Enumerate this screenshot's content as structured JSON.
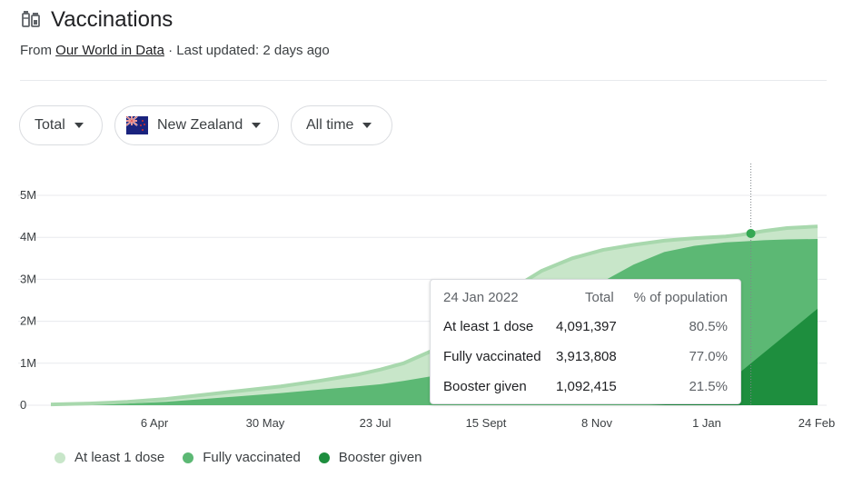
{
  "header": {
    "title": "Vaccinations",
    "source_prefix": "From ",
    "source_link": "Our World in Data",
    "source_suffix": " · Last updated: 2 days ago"
  },
  "filters": {
    "metric": "Total",
    "country": "New Zealand",
    "range": "All time"
  },
  "tooltip": {
    "date": "24 Jan 2022",
    "col_total": "Total",
    "col_pct": "% of population",
    "rows": [
      {
        "label": "At least 1 dose",
        "total": "4,091,397",
        "pct": "80.5%"
      },
      {
        "label": "Fully vaccinated",
        "total": "3,913,808",
        "pct": "77.0%"
      },
      {
        "label": "Booster given",
        "total": "1,092,415",
        "pct": "21.5%"
      }
    ]
  },
  "colors": {
    "at_least_one": "#c8e6c9",
    "at_least_one_line": "#a8d8ad",
    "fully": "#5cb874",
    "booster": "#1e8e3e",
    "grid": "#e8eaed",
    "marker": "#34a853"
  },
  "chart_data": {
    "type": "area",
    "x_ticks": [
      "6 Apr",
      "30 May",
      "23 Jul",
      "15 Sept",
      "8 Nov",
      "1 Jan",
      "24 Feb"
    ],
    "y_ticks": [
      "0",
      "1M",
      "2M",
      "3M",
      "4M",
      "5M"
    ],
    "ylim": [
      0,
      5000000
    ],
    "hover_date": "24 Jan 2022",
    "hover_x_fraction": 0.913,
    "series": [
      {
        "name": "At least 1 dose",
        "x": [
          0,
          0.05,
          0.1,
          0.15,
          0.2,
          0.25,
          0.3,
          0.35,
          0.4,
          0.43,
          0.46,
          0.5,
          0.53,
          0.56,
          0.6,
          0.64,
          0.68,
          0.72,
          0.76,
          0.8,
          0.84,
          0.88,
          0.9,
          0.93,
          0.96,
          1.0
        ],
        "values": [
          20000,
          40000,
          80000,
          150000,
          250000,
          350000,
          450000,
          580000,
          730000,
          850000,
          1000000,
          1320000,
          1700000,
          2200000,
          2750000,
          3200000,
          3500000,
          3700000,
          3820000,
          3920000,
          3980000,
          4020000,
          4060000,
          4150000,
          4220000,
          4260000
        ]
      },
      {
        "name": "Fully vaccinated",
        "x": [
          0,
          0.05,
          0.1,
          0.15,
          0.2,
          0.25,
          0.3,
          0.35,
          0.4,
          0.43,
          0.46,
          0.5,
          0.53,
          0.56,
          0.6,
          0.64,
          0.68,
          0.72,
          0.76,
          0.8,
          0.84,
          0.88,
          0.9,
          0.93,
          0.96,
          1.0
        ],
        "values": [
          10000,
          20000,
          40000,
          80000,
          150000,
          220000,
          290000,
          370000,
          450000,
          500000,
          580000,
          700000,
          830000,
          1000000,
          1350000,
          1850000,
          2450000,
          2950000,
          3350000,
          3650000,
          3800000,
          3880000,
          3900000,
          3930000,
          3950000,
          3960000
        ]
      },
      {
        "name": "Booster given",
        "x": [
          0,
          0.78,
          0.8,
          0.82,
          0.84,
          0.86,
          0.88,
          0.9,
          0.92,
          0.94,
          0.96,
          0.98,
          1.0
        ],
        "values": [
          0,
          0,
          20000,
          60000,
          130000,
          280000,
          500000,
          800000,
          1100000,
          1400000,
          1700000,
          2000000,
          2300000
        ]
      }
    ]
  },
  "legend": [
    {
      "label": "At least 1 dose",
      "color": "#c8e6c9"
    },
    {
      "label": "Fully vaccinated",
      "color": "#5cb874"
    },
    {
      "label": "Booster given",
      "color": "#1e8e3e"
    }
  ]
}
